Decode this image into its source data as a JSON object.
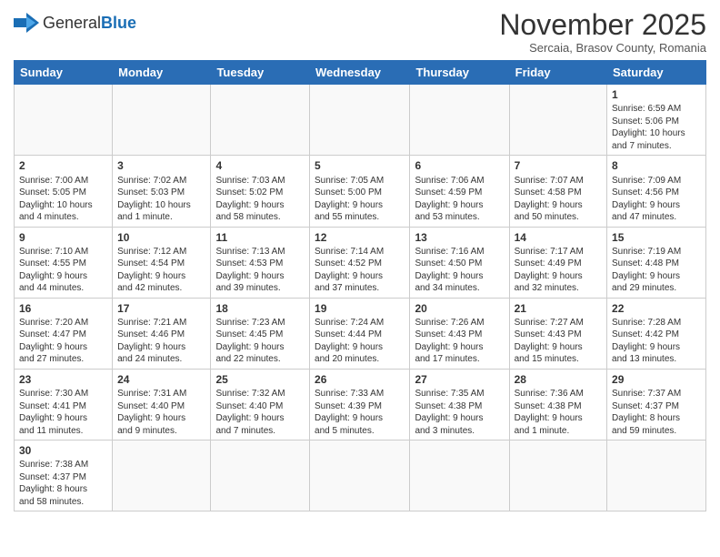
{
  "logo": {
    "text_general": "General",
    "text_blue": "Blue"
  },
  "header": {
    "month": "November 2025",
    "location": "Sercaia, Brasov County, Romania"
  },
  "weekdays": [
    "Sunday",
    "Monday",
    "Tuesday",
    "Wednesday",
    "Thursday",
    "Friday",
    "Saturday"
  ],
  "weeks": [
    [
      {
        "day": "",
        "info": ""
      },
      {
        "day": "",
        "info": ""
      },
      {
        "day": "",
        "info": ""
      },
      {
        "day": "",
        "info": ""
      },
      {
        "day": "",
        "info": ""
      },
      {
        "day": "",
        "info": ""
      },
      {
        "day": "1",
        "info": "Sunrise: 6:59 AM\nSunset: 5:06 PM\nDaylight: 10 hours\nand 7 minutes."
      }
    ],
    [
      {
        "day": "2",
        "info": "Sunrise: 7:00 AM\nSunset: 5:05 PM\nDaylight: 10 hours\nand 4 minutes."
      },
      {
        "day": "3",
        "info": "Sunrise: 7:02 AM\nSunset: 5:03 PM\nDaylight: 10 hours\nand 1 minute."
      },
      {
        "day": "4",
        "info": "Sunrise: 7:03 AM\nSunset: 5:02 PM\nDaylight: 9 hours\nand 58 minutes."
      },
      {
        "day": "5",
        "info": "Sunrise: 7:05 AM\nSunset: 5:00 PM\nDaylight: 9 hours\nand 55 minutes."
      },
      {
        "day": "6",
        "info": "Sunrise: 7:06 AM\nSunset: 4:59 PM\nDaylight: 9 hours\nand 53 minutes."
      },
      {
        "day": "7",
        "info": "Sunrise: 7:07 AM\nSunset: 4:58 PM\nDaylight: 9 hours\nand 50 minutes."
      },
      {
        "day": "8",
        "info": "Sunrise: 7:09 AM\nSunset: 4:56 PM\nDaylight: 9 hours\nand 47 minutes."
      }
    ],
    [
      {
        "day": "9",
        "info": "Sunrise: 7:10 AM\nSunset: 4:55 PM\nDaylight: 9 hours\nand 44 minutes."
      },
      {
        "day": "10",
        "info": "Sunrise: 7:12 AM\nSunset: 4:54 PM\nDaylight: 9 hours\nand 42 minutes."
      },
      {
        "day": "11",
        "info": "Sunrise: 7:13 AM\nSunset: 4:53 PM\nDaylight: 9 hours\nand 39 minutes."
      },
      {
        "day": "12",
        "info": "Sunrise: 7:14 AM\nSunset: 4:52 PM\nDaylight: 9 hours\nand 37 minutes."
      },
      {
        "day": "13",
        "info": "Sunrise: 7:16 AM\nSunset: 4:50 PM\nDaylight: 9 hours\nand 34 minutes."
      },
      {
        "day": "14",
        "info": "Sunrise: 7:17 AM\nSunset: 4:49 PM\nDaylight: 9 hours\nand 32 minutes."
      },
      {
        "day": "15",
        "info": "Sunrise: 7:19 AM\nSunset: 4:48 PM\nDaylight: 9 hours\nand 29 minutes."
      }
    ],
    [
      {
        "day": "16",
        "info": "Sunrise: 7:20 AM\nSunset: 4:47 PM\nDaylight: 9 hours\nand 27 minutes."
      },
      {
        "day": "17",
        "info": "Sunrise: 7:21 AM\nSunset: 4:46 PM\nDaylight: 9 hours\nand 24 minutes."
      },
      {
        "day": "18",
        "info": "Sunrise: 7:23 AM\nSunset: 4:45 PM\nDaylight: 9 hours\nand 22 minutes."
      },
      {
        "day": "19",
        "info": "Sunrise: 7:24 AM\nSunset: 4:44 PM\nDaylight: 9 hours\nand 20 minutes."
      },
      {
        "day": "20",
        "info": "Sunrise: 7:26 AM\nSunset: 4:43 PM\nDaylight: 9 hours\nand 17 minutes."
      },
      {
        "day": "21",
        "info": "Sunrise: 7:27 AM\nSunset: 4:43 PM\nDaylight: 9 hours\nand 15 minutes."
      },
      {
        "day": "22",
        "info": "Sunrise: 7:28 AM\nSunset: 4:42 PM\nDaylight: 9 hours\nand 13 minutes."
      }
    ],
    [
      {
        "day": "23",
        "info": "Sunrise: 7:30 AM\nSunset: 4:41 PM\nDaylight: 9 hours\nand 11 minutes."
      },
      {
        "day": "24",
        "info": "Sunrise: 7:31 AM\nSunset: 4:40 PM\nDaylight: 9 hours\nand 9 minutes."
      },
      {
        "day": "25",
        "info": "Sunrise: 7:32 AM\nSunset: 4:40 PM\nDaylight: 9 hours\nand 7 minutes."
      },
      {
        "day": "26",
        "info": "Sunrise: 7:33 AM\nSunset: 4:39 PM\nDaylight: 9 hours\nand 5 minutes."
      },
      {
        "day": "27",
        "info": "Sunrise: 7:35 AM\nSunset: 4:38 PM\nDaylight: 9 hours\nand 3 minutes."
      },
      {
        "day": "28",
        "info": "Sunrise: 7:36 AM\nSunset: 4:38 PM\nDaylight: 9 hours\nand 1 minute."
      },
      {
        "day": "29",
        "info": "Sunrise: 7:37 AM\nSunset: 4:37 PM\nDaylight: 8 hours\nand 59 minutes."
      }
    ],
    [
      {
        "day": "30",
        "info": "Sunrise: 7:38 AM\nSunset: 4:37 PM\nDaylight: 8 hours\nand 58 minutes."
      },
      {
        "day": "",
        "info": ""
      },
      {
        "day": "",
        "info": ""
      },
      {
        "day": "",
        "info": ""
      },
      {
        "day": "",
        "info": ""
      },
      {
        "day": "",
        "info": ""
      },
      {
        "day": "",
        "info": ""
      }
    ]
  ]
}
